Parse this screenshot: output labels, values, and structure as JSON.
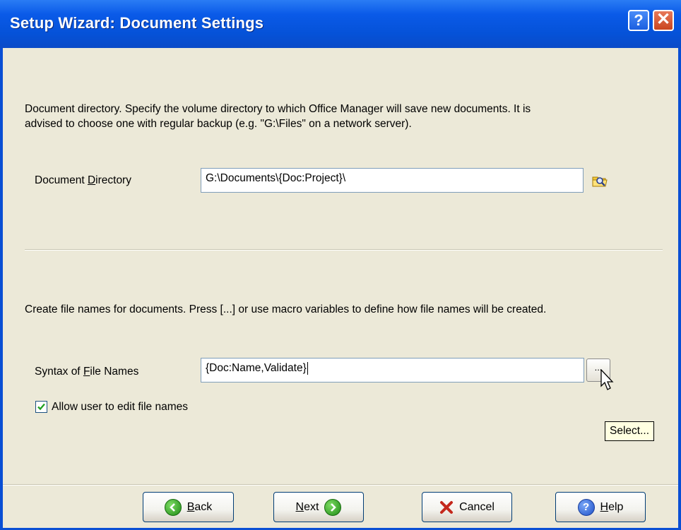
{
  "window": {
    "title": "Setup Wizard: Document Settings",
    "help_glyph": "?",
    "close_glyph": "✕"
  },
  "document": {
    "description_line1": "Document directory. Specify the volume directory to which Office Manager will save new documents. It is",
    "description_line2": "advised to choose one with regular backup (e.g. \"G:\\Files\" on a network server).",
    "label_pre": "Document ",
    "label_accel": "D",
    "label_post": "irectory",
    "value": "G:\\Documents\\{Doc:Project}\\",
    "browse_icon": "folder-search-icon"
  },
  "filenames": {
    "description": "Create file names for documents. Press [...] or use macro variables to define how file names will be created.",
    "label_pre": "Syntax of ",
    "label_accel": "F",
    "label_post": "ile Names",
    "value": "{Doc:Name,Validate}",
    "dots_label": "...",
    "tooltip": "Select...",
    "allow_edit_label": "Allow user to edit file names",
    "allow_edit_checked": true
  },
  "buttons": {
    "back_accel": "B",
    "back_rest": "ack",
    "next_accel": "N",
    "next_rest": "ext",
    "cancel": "Cancel",
    "help_accel": "H",
    "help_rest": "elp"
  },
  "colors": {
    "titlebar": "#0a5ae8",
    "client": "#ece9d8",
    "checkmark": "#21a121",
    "cancel_x": "#c4281c",
    "tooltip_bg": "#ffffe1"
  }
}
